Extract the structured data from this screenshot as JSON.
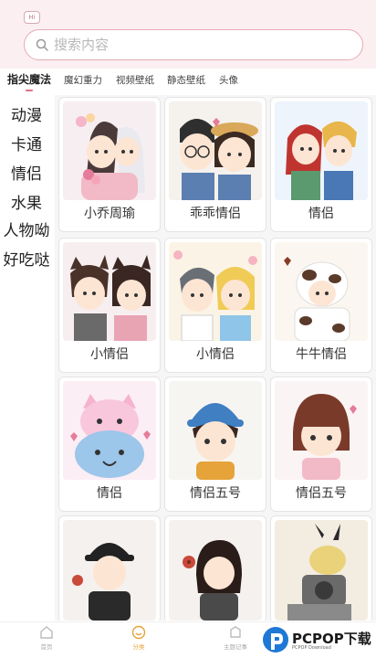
{
  "header": {
    "hi_badge": "Hi",
    "search": {
      "placeholder": "搜索内容",
      "value": ""
    }
  },
  "tabs": [
    "指尖魔法",
    "魔幻重力",
    "视频壁纸",
    "静态壁纸",
    "头像"
  ],
  "active_tab": "指尖魔法",
  "sidebar": [
    "动漫",
    "卡通",
    "情侣",
    "水果",
    "人物呦",
    "好吃哒"
  ],
  "cards": [
    {
      "label": "小乔周瑜",
      "icon": "couple-anime-avatar"
    },
    {
      "label": "乖乖情侣",
      "icon": "couple-glasses-avatar"
    },
    {
      "label": "情侣",
      "icon": "couple-redhair-avatar"
    },
    {
      "label": "小情侣",
      "icon": "couple-cat-ears-avatar"
    },
    {
      "label": "小情侣",
      "icon": "couple-flowers-avatar"
    },
    {
      "label": "牛牛情侣",
      "icon": "couple-cow-costume-avatar"
    },
    {
      "label": "情侣",
      "icon": "cute-cat-faces-avatar"
    },
    {
      "label": "情侣五号",
      "icon": "boy-blue-hat-avatar"
    },
    {
      "label": "情侣五号",
      "icon": "girl-bob-hair-avatar"
    },
    {
      "label": "",
      "icon": "boy-black-hat-avatar"
    },
    {
      "label": "",
      "icon": "girl-flower-avatar"
    },
    {
      "label": "",
      "icon": "pikachu-camera-avatar"
    }
  ],
  "bottom_nav": [
    {
      "label": "首页",
      "icon": "home-icon"
    },
    {
      "label": "分类",
      "icon": "category-icon"
    },
    {
      "label": "主题记事",
      "icon": "theme-icon"
    }
  ],
  "watermark": {
    "text": "PCPOP下载",
    "sub": "PCPOP Download"
  },
  "colors": {
    "accent": "#e0707f",
    "header_bg": "#fbeff1",
    "search_border": "#e6aab5",
    "active_nav": "#e5a33a"
  }
}
